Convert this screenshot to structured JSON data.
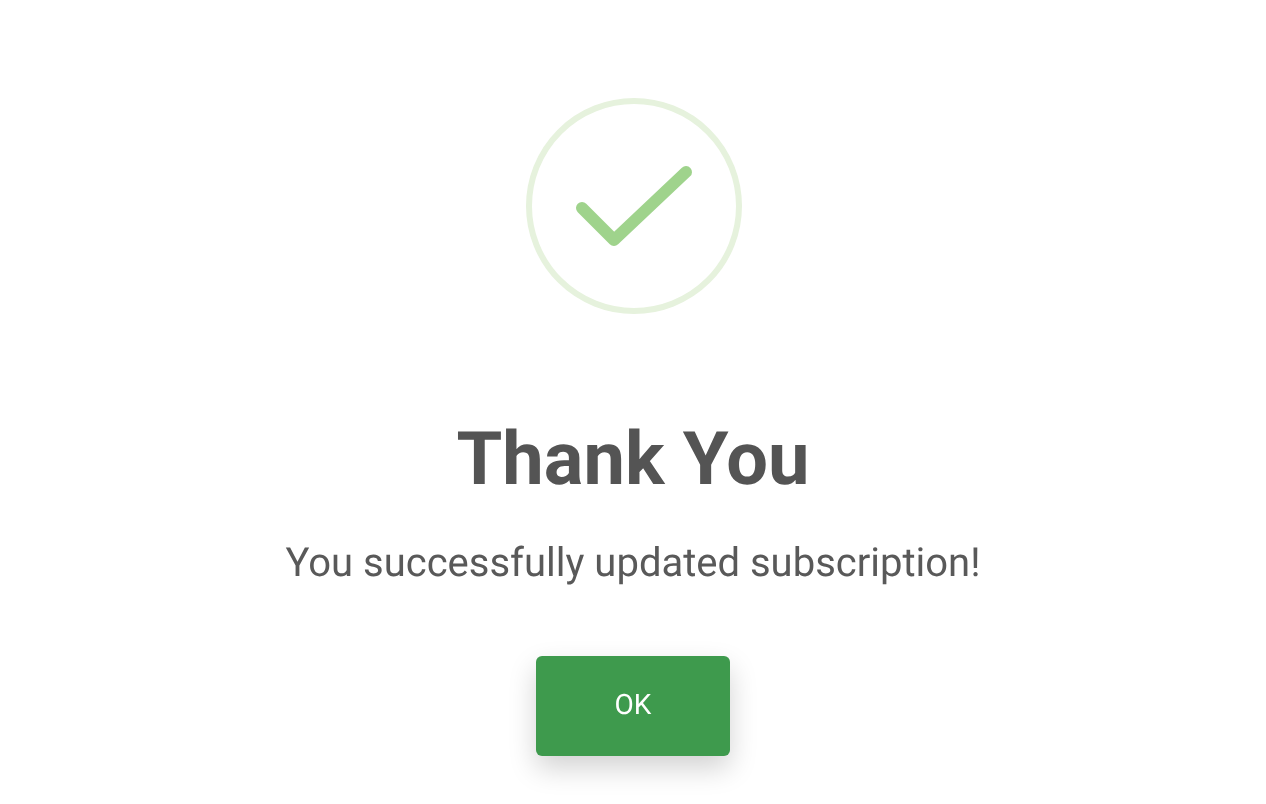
{
  "dialog": {
    "title": "Thank You",
    "message": "You successfully updated subscription!",
    "button": "OK"
  }
}
